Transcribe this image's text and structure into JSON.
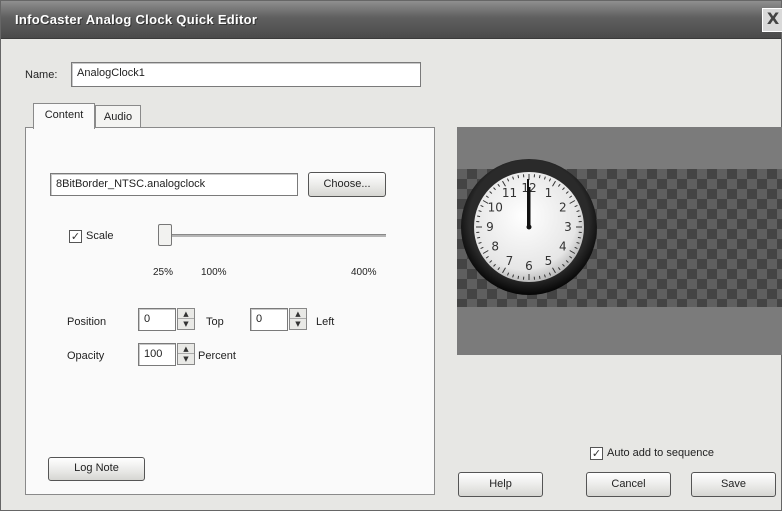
{
  "window": {
    "title": "InfoCaster Analog Clock Quick Editor",
    "close_glyph": "X"
  },
  "name_field": {
    "label": "Name:",
    "value": "AnalogClock1"
  },
  "tabs": [
    {
      "label": "Content"
    },
    {
      "label": "Audio"
    }
  ],
  "content": {
    "file": {
      "value": "8BitBorder_NTSC.analogclock",
      "choose_label": "Choose..."
    },
    "scale": {
      "label": "Scale",
      "checked": true,
      "checkmark": "✓",
      "tick_min": "25%",
      "tick_default": "100%",
      "tick_max": "400%"
    },
    "position": {
      "label": "Position",
      "top_value": "0",
      "top_label": "Top",
      "left_value": "0",
      "left_label": "Left"
    },
    "opacity": {
      "label": "Opacity",
      "value": "100",
      "unit_label": "Percent"
    },
    "log_note_label": "Log Note"
  },
  "preview": {
    "clock_numerals": [
      "12",
      "1",
      "2",
      "3",
      "4",
      "5",
      "6",
      "7",
      "8",
      "9",
      "10",
      "11"
    ]
  },
  "auto_add": {
    "label": "Auto add to sequence",
    "checked": true,
    "checkmark": "✓"
  },
  "buttons": {
    "help": "Help",
    "cancel": "Cancel",
    "save": "Save"
  }
}
